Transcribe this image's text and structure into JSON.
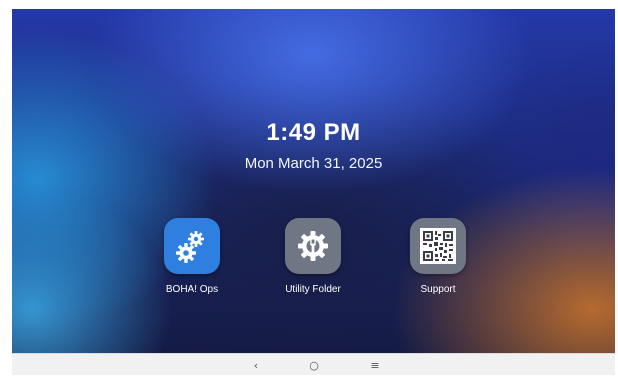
{
  "status": {
    "time": "1:49 PM",
    "date": "Mon March 31, 2025"
  },
  "apps": [
    {
      "label": "BOHA! Ops",
      "icon": "gears-icon",
      "color": "#2f7fe0"
    },
    {
      "label": "Utility Folder",
      "icon": "wrench-gear-icon",
      "color": "#707784"
    },
    {
      "label": "Support",
      "icon": "qr-code-icon",
      "color": "#707784"
    }
  ],
  "navbar": {
    "back": "‹",
    "home": "○",
    "recents": "≡"
  }
}
